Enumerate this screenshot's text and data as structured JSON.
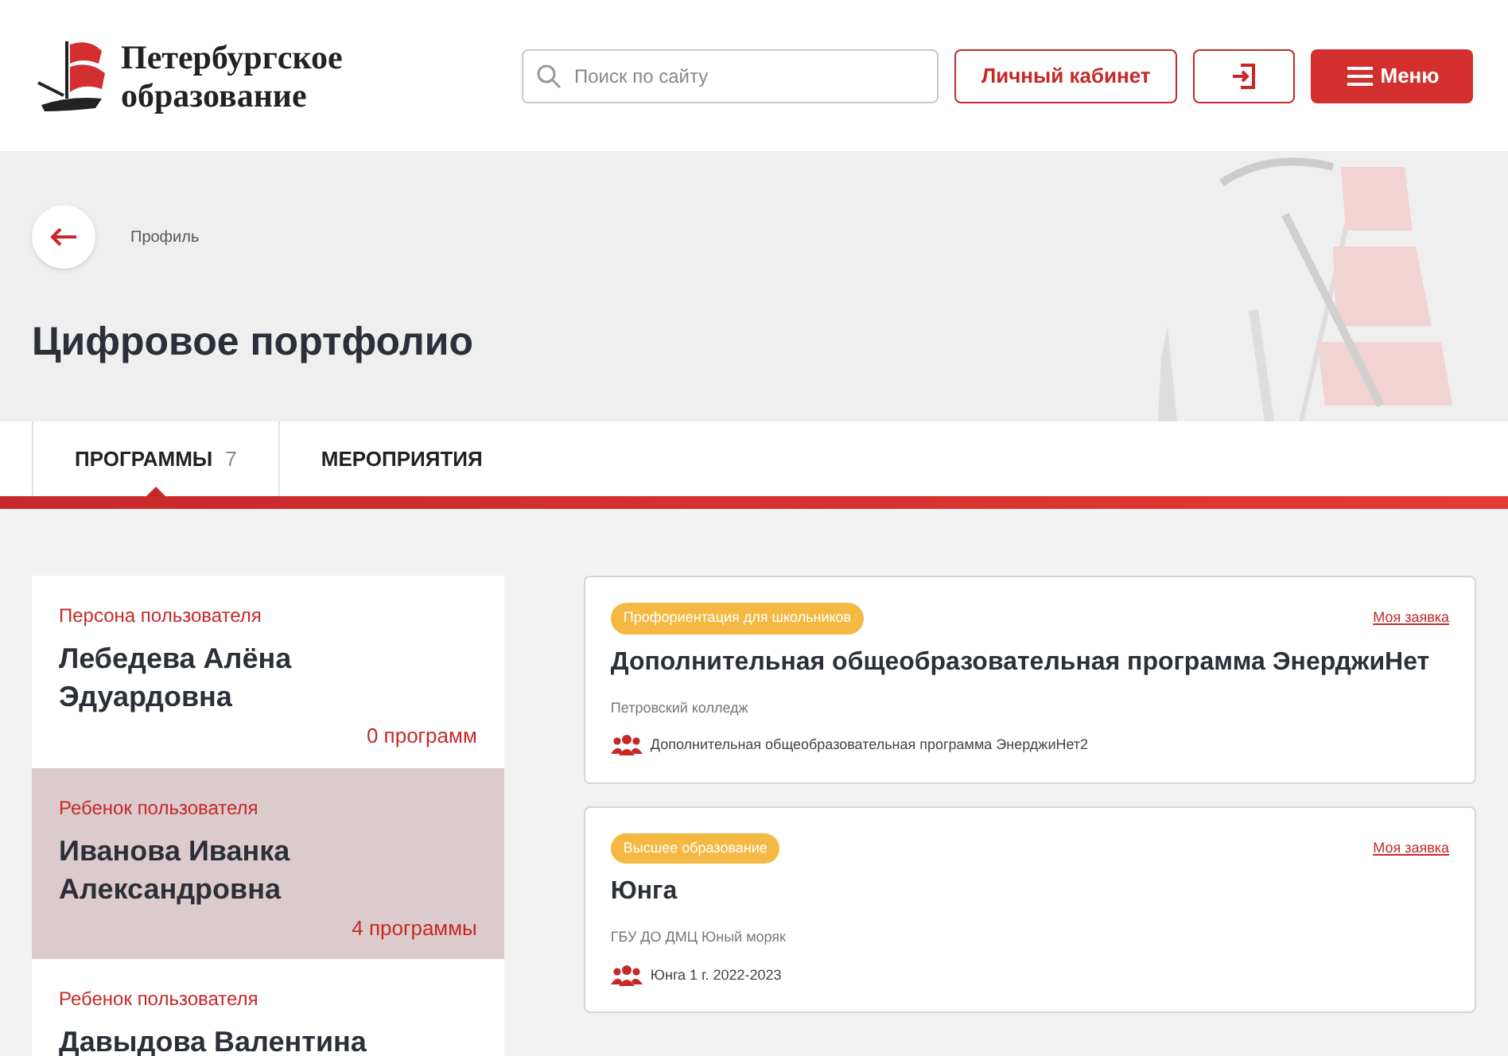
{
  "logo": {
    "line_1": "Петербургское",
    "line_2": "образование"
  },
  "search": {
    "placeholder": "Поиск по сайту"
  },
  "header_buttons": {
    "account": "Личный кабинет",
    "menu": "Меню"
  },
  "breadcrumb": "Профиль",
  "page_title": "Цифровое портфолио",
  "tabs": [
    {
      "label": "ПРОГРАММЫ",
      "count": "7",
      "selected": true
    },
    {
      "label": "МЕРОПРИЯТИЯ",
      "selected": false
    }
  ],
  "persons": [
    {
      "role": "Персона пользователя",
      "name": "Лебедева Алёна Эдуардовна",
      "count": "0 программ",
      "selected": false
    },
    {
      "role": "Ребенок пользователя",
      "name": "Иванова Иванка Александровна",
      "count": "4 программы",
      "selected": true
    },
    {
      "role": "Ребенок пользователя",
      "name": "Давыдова Валентина",
      "selected": false
    }
  ],
  "programs": [
    {
      "tag": "Профориентация для школьников",
      "link": "Моя заявка",
      "title": "Дополнительная общеобразовательная программа ЭнерджиНет",
      "org": "Петровский колледж",
      "group": "Дополнительная общеобразовательная программа ЭнерджиНет2"
    },
    {
      "tag": "Высшее образование",
      "link": "Моя заявка",
      "title": "Юнга",
      "org": "ГБУ ДО ДМЦ Юный моряк",
      "group": "Юнга 1 г. 2022-2023"
    }
  ]
}
